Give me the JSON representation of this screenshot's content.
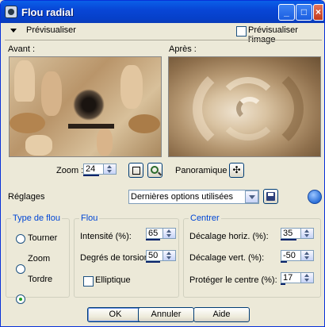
{
  "window": {
    "title": "Flou radial"
  },
  "toolbar": {
    "preview_label": "Prévisualiser",
    "preview_image_label": "Prévisualiser l'image"
  },
  "previews": {
    "before_label": "Avant :",
    "after_label": "Après :"
  },
  "zoom": {
    "label": "Zoom :",
    "value": "24"
  },
  "panoramic": {
    "label": "Panoramique :"
  },
  "settings": {
    "label": "Réglages",
    "selected": "Dernières options utilisées"
  },
  "blur_type": {
    "legend": "Type de flou",
    "options": [
      "Tourner",
      "Zoom",
      "Tordre"
    ],
    "selected": "Tordre"
  },
  "blur": {
    "legend": "Flou",
    "intensity_label": "Intensité (%):",
    "intensity_value": "65",
    "torsion_label": "Degrés de torsion :",
    "torsion_value": "50",
    "elliptic_label": "Elliptique"
  },
  "center": {
    "legend": "Centrer",
    "h_offset_label": "Décalage horiz. (%):",
    "h_offset_value": "35",
    "v_offset_label": "Décalage vert. (%):",
    "v_offset_value": "-50",
    "protect_label": "Protéger le centre (%):",
    "protect_value": "17"
  },
  "buttons": {
    "ok": "OK",
    "cancel": "Annuler",
    "help": "Aide"
  },
  "colors": {
    "titlebar": "#0846d6",
    "group_label": "#0046d5",
    "face": "#ece9d8"
  }
}
